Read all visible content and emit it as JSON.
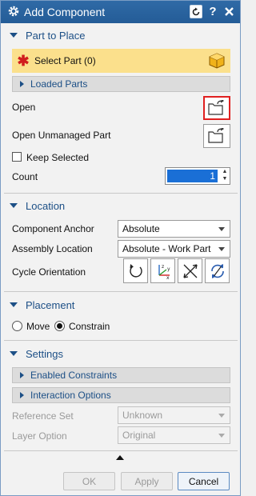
{
  "window": {
    "title": "Add Component",
    "help_label": "?",
    "close_label": "X"
  },
  "part_to_place": {
    "header": "Part to Place",
    "select_part": "Select Part (0)",
    "loaded_parts": "Loaded Parts",
    "open": "Open",
    "open_unmanaged": "Open Unmanaged Part",
    "keep_selected": "Keep Selected",
    "keep_selected_checked": false,
    "count_label": "Count",
    "count_value": "1"
  },
  "location": {
    "header": "Location",
    "component_anchor_label": "Component Anchor",
    "component_anchor_value": "Absolute",
    "assembly_location_label": "Assembly Location",
    "assembly_location_value": "Absolute - Work Part",
    "cycle_orientation_label": "Cycle Orientation",
    "cycle_icons": [
      "reset-rotate-icon",
      "csys-xyz-icon",
      "reverse-direction-icon",
      "rotate-arrows-icon"
    ]
  },
  "placement": {
    "header": "Placement",
    "options": [
      "Move",
      "Constrain"
    ],
    "selected": "Constrain"
  },
  "settings": {
    "header": "Settings",
    "enabled_constraints": "Enabled Constraints",
    "interaction_options": "Interaction Options",
    "reference_set_label": "Reference Set",
    "reference_set_value": "Unknown",
    "layer_option_label": "Layer Option",
    "layer_option_value": "Original"
  },
  "footer": {
    "ok": "OK",
    "apply": "Apply",
    "cancel": "Cancel"
  },
  "colors": {
    "title_bar": "#2f6aa6",
    "section_header": "#1c4f86",
    "select_highlight": "#fbe08c",
    "required_star": "#d01c1c",
    "focus_red": "#e02020",
    "spinner_selection": "#1a6fd6"
  }
}
